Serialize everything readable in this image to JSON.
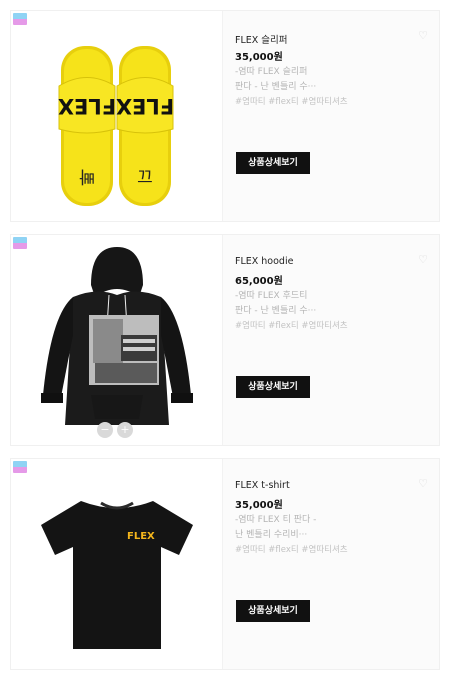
{
  "products": [
    {
      "badge": "new-badge-icon",
      "name": "FLEX 슬리퍼",
      "price": "35,000원",
      "desc_line1": "-염따 FLEX 슬리퍼",
      "desc_line2": "판다 - 난 벤틀리 수···",
      "tags": "#염따티 #flex티 #염따티셔츠",
      "button": "상품상세보기",
      "image": "yellow-slippers-image",
      "image_text_top": "FLEX",
      "image_text_bottom_left": "빠",
      "image_text_bottom_right": "끄"
    },
    {
      "badge": "new-badge-icon",
      "name": "FLEX hoodie",
      "price": "65,000원",
      "desc_line1": "-염따 FLEX 후드티",
      "desc_line2": "판다 - 난 벤틀리 수···",
      "tags": "#염따티 #flex티 #염따티셔츠",
      "button": "상품상세보기",
      "image": "black-hoodie-image",
      "zoom_out": "−",
      "zoom_in": "+"
    },
    {
      "badge": "new-badge-icon",
      "name": "FLEX t-shirt",
      "price": "35,000원",
      "desc_line1": "-염따 FLEX 티 판다 -",
      "desc_line2": "난 벤틀리 수리비···",
      "tags": "#염따티 #flex티 #염따티셔츠",
      "button": "상품상세보기",
      "image": "black-tshirt-image",
      "image_text": "FLEX"
    }
  ],
  "colors": {
    "slipper_yellow": "#f6e31a",
    "button_bg": "#111111",
    "tshirt_logo": "#f3b51c"
  }
}
